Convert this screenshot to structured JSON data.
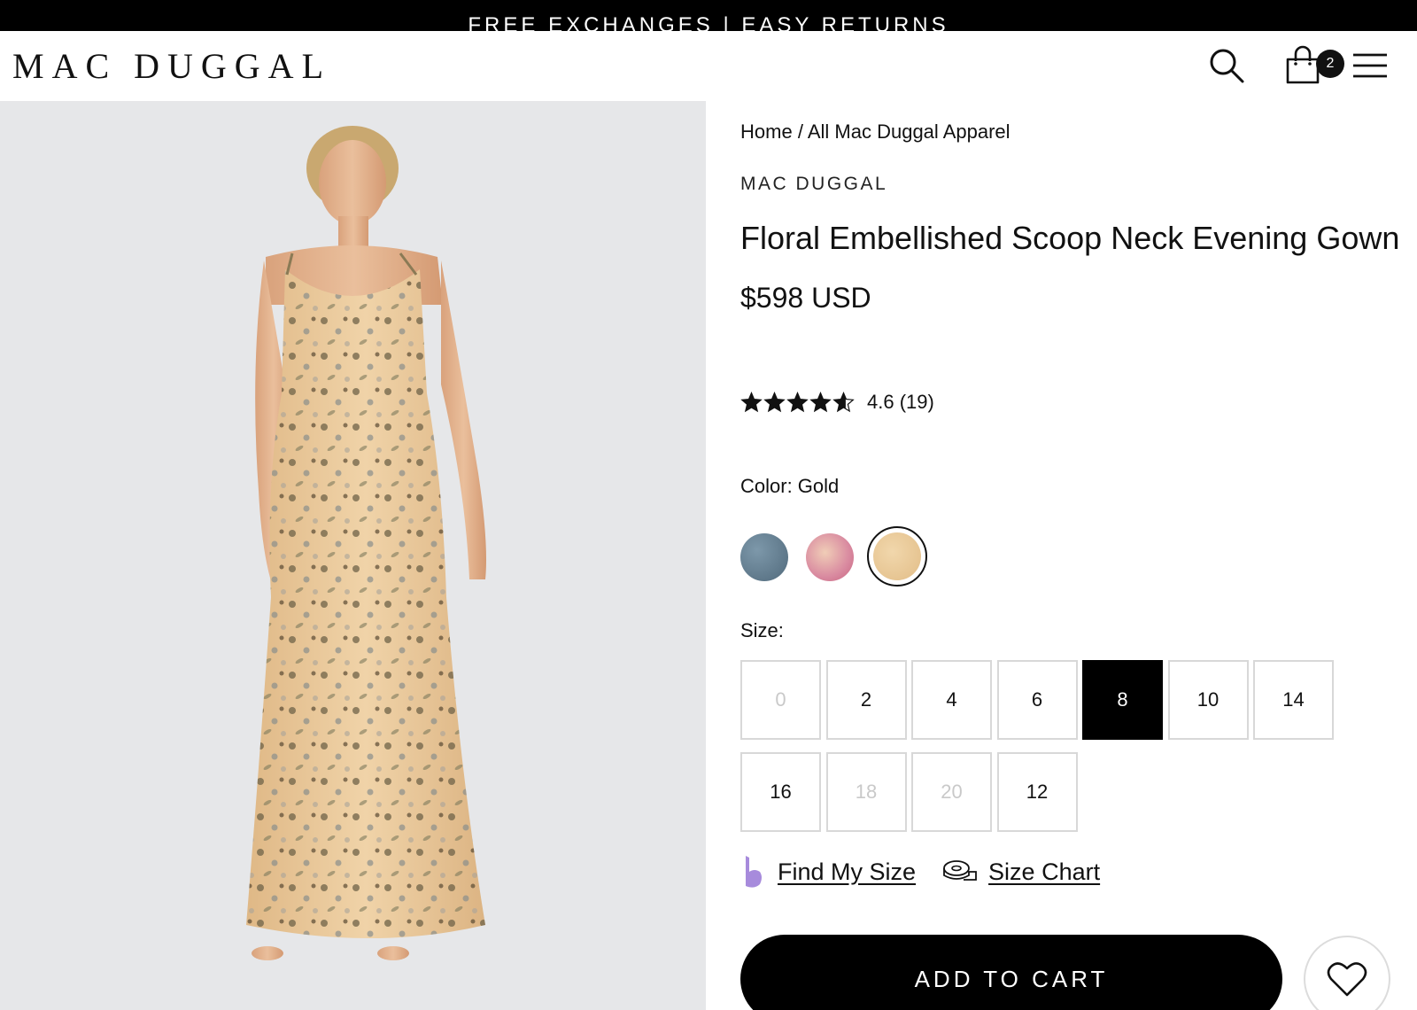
{
  "announcement": "FREE EXCHANGES | EASY RETURNS",
  "header": {
    "logo": "MAC DUGGAL",
    "cart_count": "2",
    "icons": [
      "search-icon",
      "shopping-bag-icon",
      "hamburger-menu-icon"
    ]
  },
  "breadcrumb": {
    "home": "Home",
    "separator": "/",
    "current": "All Mac Duggal Apparel"
  },
  "product": {
    "brand": "MAC DUGGAL",
    "title": "Floral Embellished Scoop Neck Evening Gown",
    "price": "$598 USD",
    "rating": {
      "value": 4.6,
      "value_text": "4.6",
      "count_text": "(19)",
      "stars_max": 5
    },
    "color_label": "Color: Gold",
    "colors": [
      {
        "name": "slate-blue",
        "hex": "#6b8496"
      },
      {
        "name": "pink",
        "hex": "#d98aa0"
      },
      {
        "name": "gold",
        "hex": "#e6c38f",
        "selected": true
      }
    ],
    "size_label": "Size:",
    "sizes": [
      {
        "label": "0",
        "available": false
      },
      {
        "label": "2",
        "available": true
      },
      {
        "label": "4",
        "available": true
      },
      {
        "label": "6",
        "available": true
      },
      {
        "label": "8",
        "available": true,
        "selected": true
      },
      {
        "label": "10",
        "available": true
      },
      {
        "label": "14",
        "available": true
      },
      {
        "label": "16",
        "available": true
      },
      {
        "label": "18",
        "available": false
      },
      {
        "label": "20",
        "available": false
      },
      {
        "label": "12",
        "available": true
      }
    ],
    "find_my_size": "Find My Size",
    "size_chart": "Size Chart",
    "add_to_cart": "ADD TO CART"
  },
  "colors": {
    "accent": "#000000",
    "image_background": "#e6e7e9",
    "disabled_text": "#c9c9c9",
    "border": "#d8d8d8",
    "fit_icon": "#a78bdc"
  }
}
